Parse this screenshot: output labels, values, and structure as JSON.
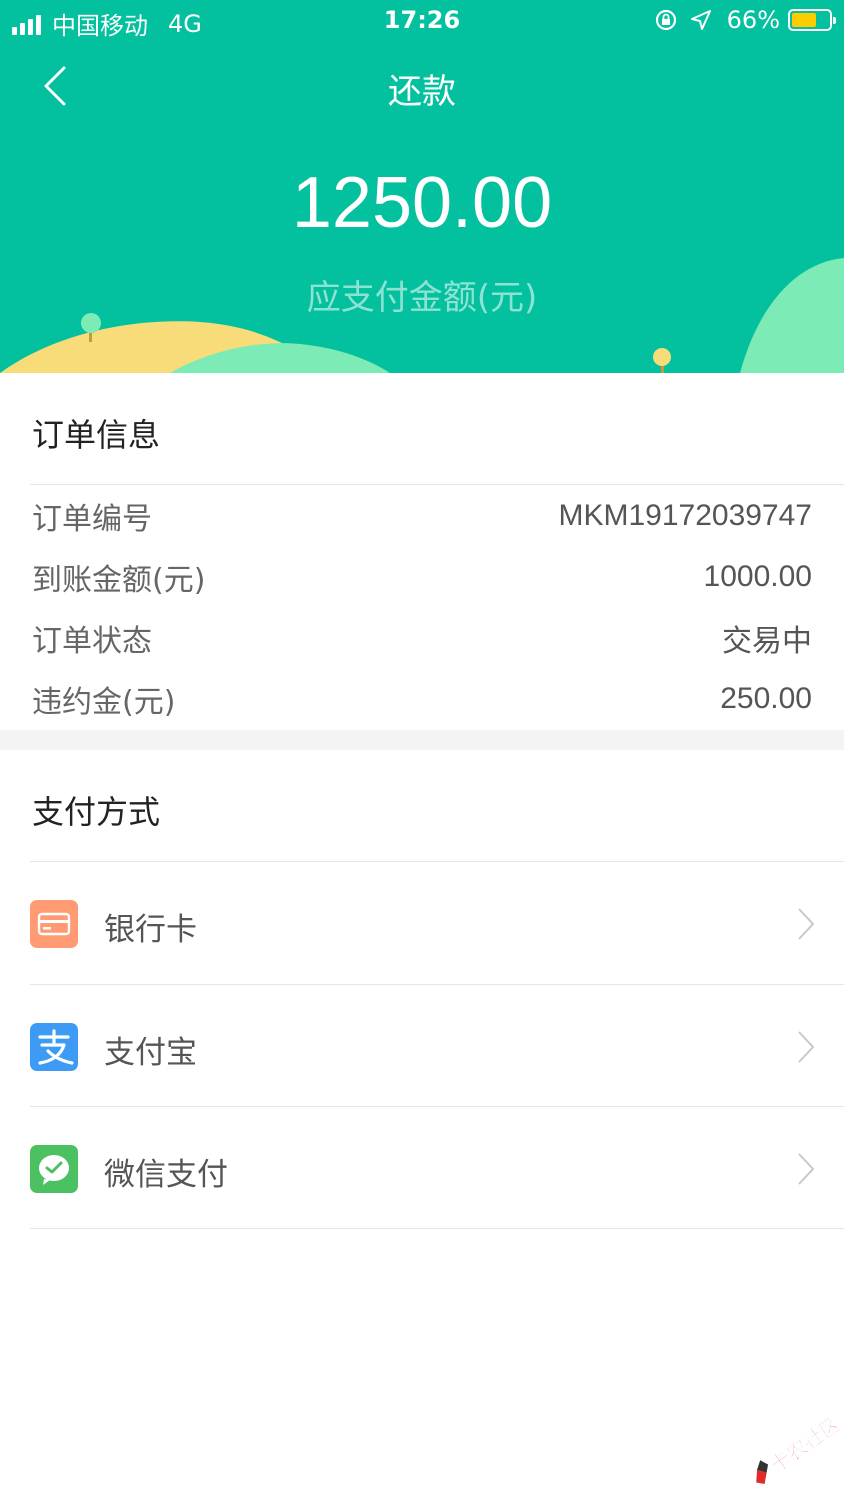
{
  "status_bar": {
    "carrier": "中国移动",
    "network": "4G",
    "time": "17:26",
    "battery_text": "66%",
    "battery_level": 0.66
  },
  "nav": {
    "title": "还款",
    "back_icon": "chevron-left-icon"
  },
  "payment": {
    "amount": "1250.00",
    "amount_label": "应支付金额(元)"
  },
  "order_info": {
    "title": "订单信息",
    "rows": [
      {
        "label": "订单编号",
        "value": "MKM19172039747"
      },
      {
        "label": "到账金额(元)",
        "value": "1000.00"
      },
      {
        "label": "订单状态",
        "value": "交易中"
      },
      {
        "label": "违约金(元)",
        "value": "250.00"
      }
    ]
  },
  "payment_methods": {
    "title": "支付方式",
    "items": [
      {
        "label": "银行卡",
        "icon": "bank-card-icon",
        "color": "#FF9A73"
      },
      {
        "label": "支付宝",
        "icon": "alipay-icon",
        "color": "#3D9BF5"
      },
      {
        "label": "微信支付",
        "icon": "wechat-pay-icon",
        "color": "#4CC161"
      }
    ]
  },
  "colors": {
    "header_bg": "#03C09E",
    "hill_yellow": "#F8DC79",
    "hill_green": "#7DEBB6"
  },
  "watermark": {
    "text": "卡农社区"
  }
}
